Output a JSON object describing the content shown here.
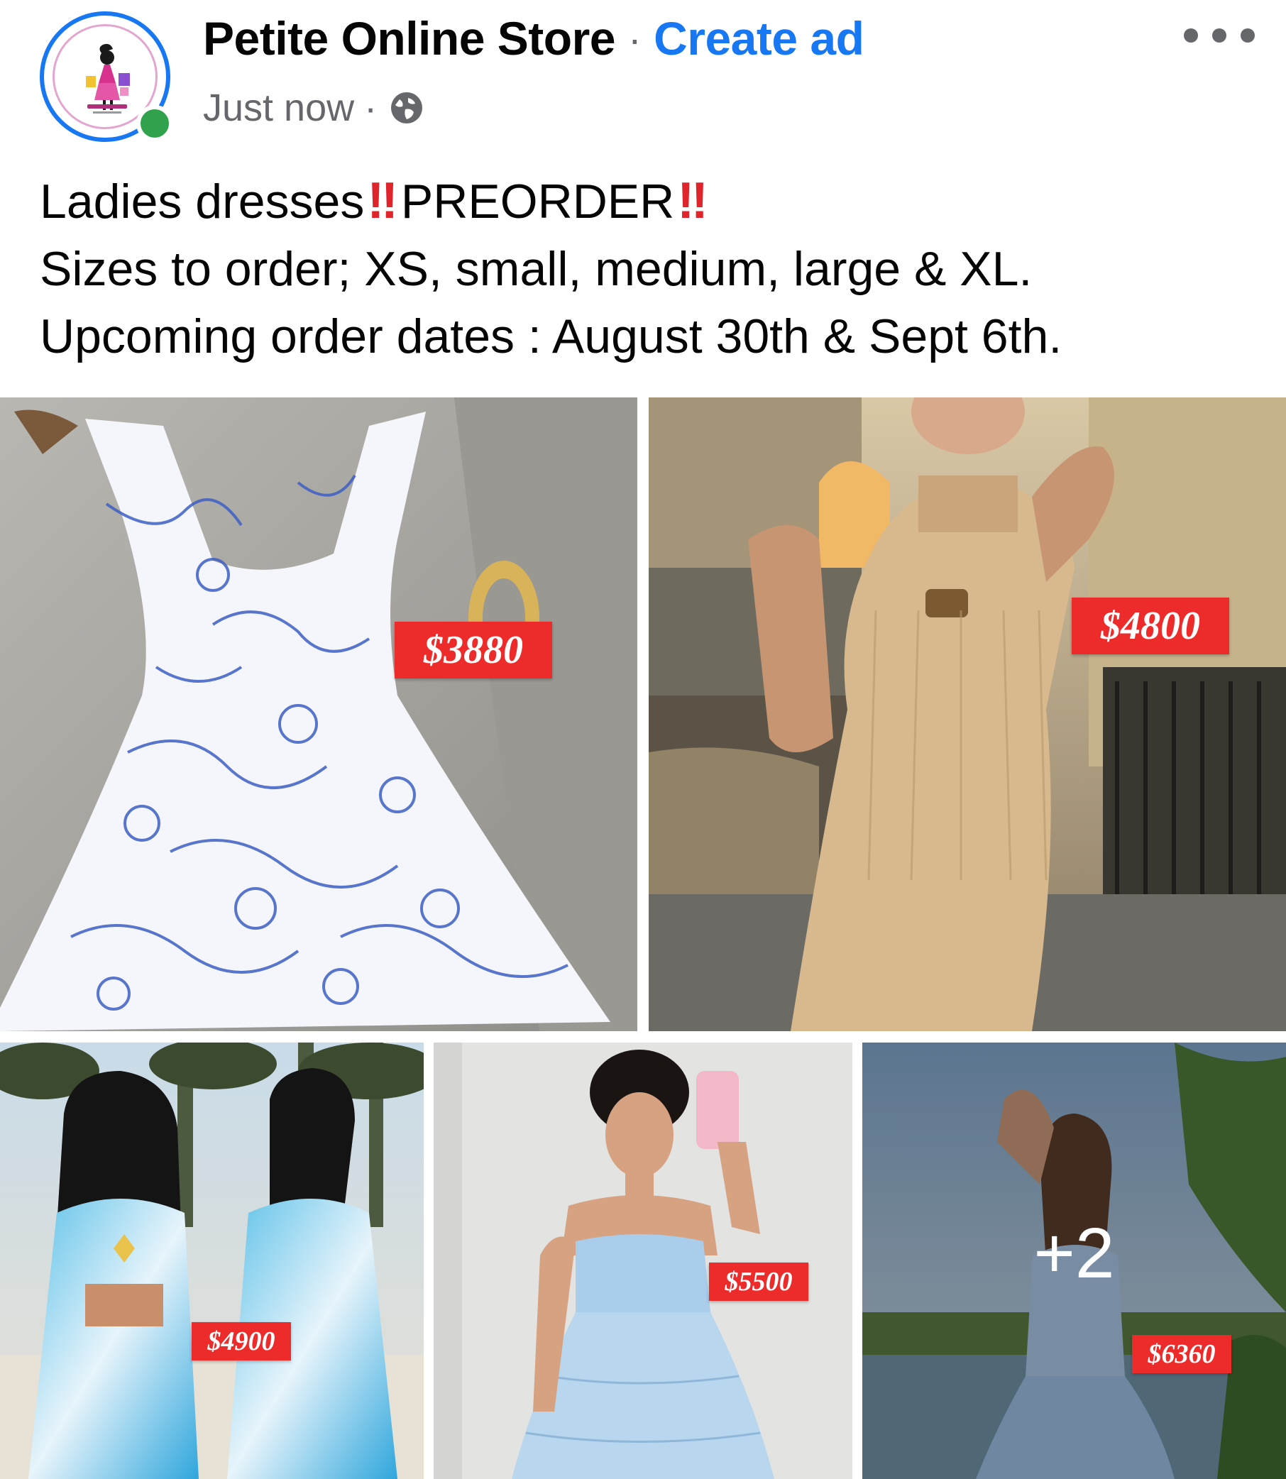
{
  "header": {
    "page_name": "Petite Online Store",
    "separator": "·",
    "create_ad_label": "Create ad",
    "timestamp": "Just now",
    "meta_separator": "·",
    "audience_icon": "globe-icon",
    "more_icon": "more-options-icon",
    "online_status": "online"
  },
  "post": {
    "line1_part1": "Ladies dresses",
    "line1_bang1": "‼",
    "line1_part2": "PREORDER",
    "line1_bang2": "‼",
    "line2": "Sizes to order; XS, small, medium, large & XL.",
    "line3": "Upcoming order dates : August 30th & Sept 6th."
  },
  "photos": [
    {
      "price": "$3880",
      "description": "white dress with blue shell print"
    },
    {
      "price": "$4800",
      "description": "beige halter dress"
    },
    {
      "price": "$4900",
      "description": "blue tie-dye dress at beach"
    },
    {
      "price": "$5500",
      "description": "light blue tiered dress"
    },
    {
      "price": "$6360",
      "description": "light blue halter dress by water"
    }
  ],
  "more_photos_label": "+2",
  "colors": {
    "accent_blue": "#1877f2",
    "price_red": "#ed2b2b",
    "online_green": "#31a24c",
    "meta_gray": "#65676b"
  }
}
